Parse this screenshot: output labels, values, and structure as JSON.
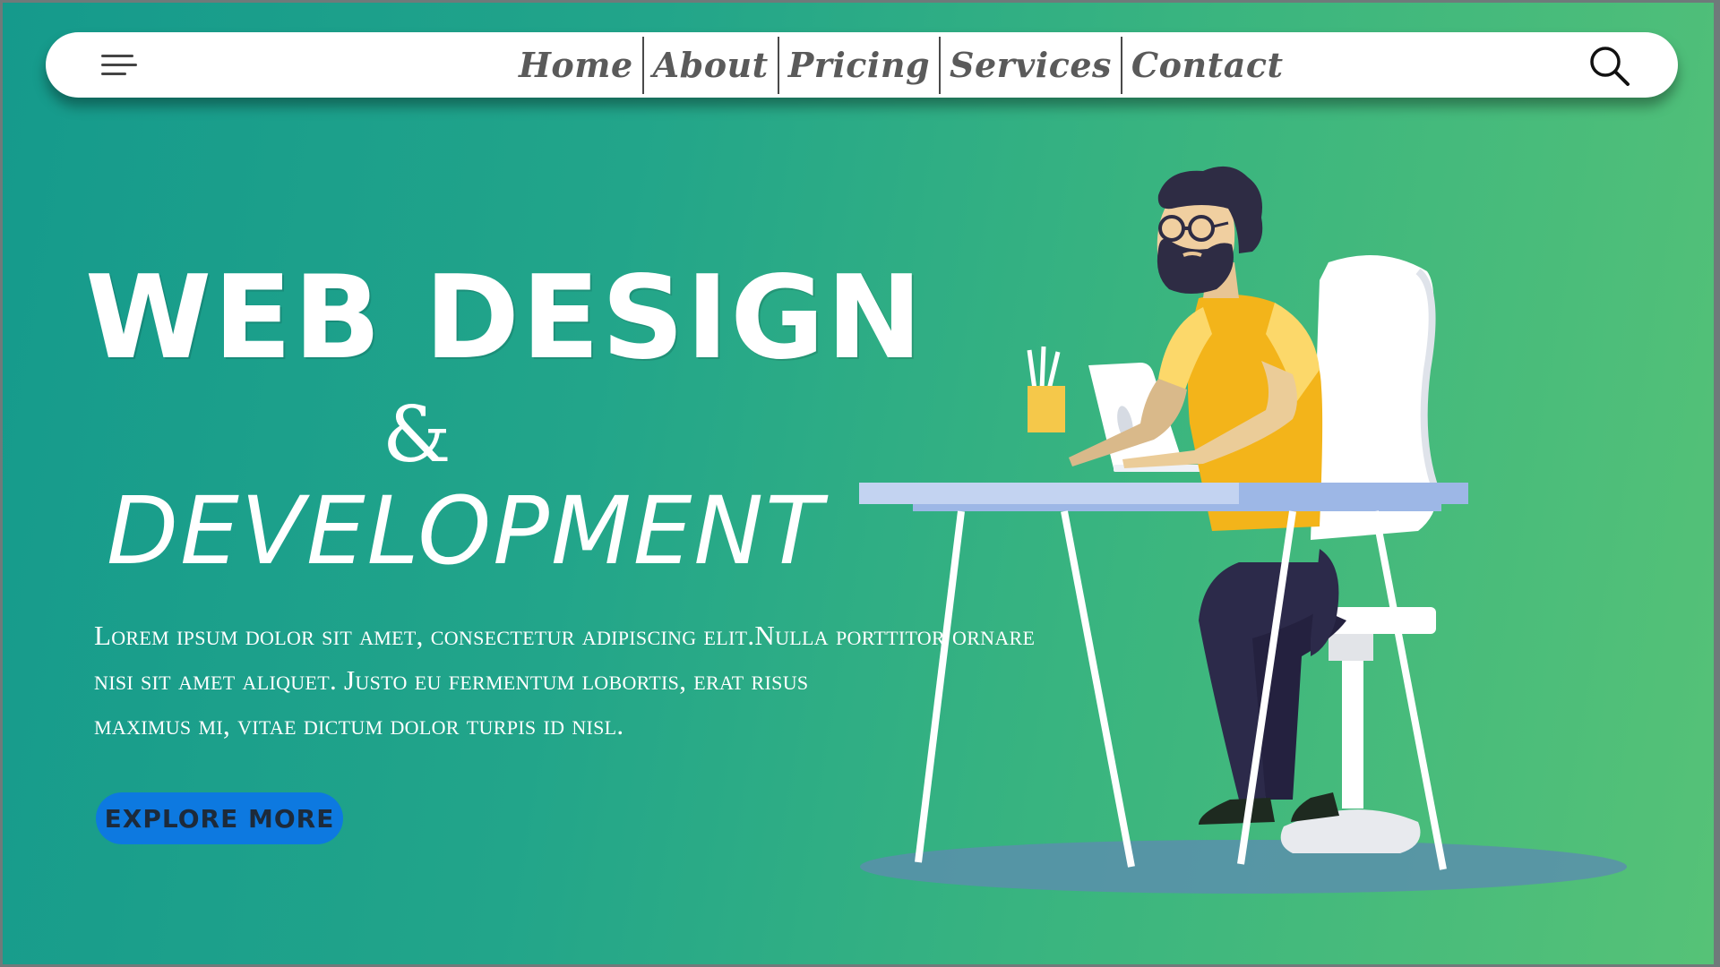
{
  "nav": {
    "menu_icon": "hamburger-menu-icon",
    "links": [
      "Home",
      "About",
      "Pricing",
      "Services",
      "Contact"
    ],
    "search_icon": "search-icon"
  },
  "hero": {
    "title_line1": "WEB DESIGN",
    "title_amp": "&",
    "title_line2": "DEVELOPMENT",
    "body_lines": [
      "Lorem ipsum dolor sit amet, consectetur adipiscing elit.Nulla porttitor ornare",
      " nisi sit amet aliquet. Justo eu fermentum lobortis, erat risus",
      "maximus mi, vitae dictum dolor turpis id nisl."
    ],
    "cta_label": "EXPLORE MORE"
  },
  "colors": {
    "gradient_start": "#159a8c",
    "gradient_end": "#56c277",
    "cta_background": "#0d79e0",
    "nav_background": "#ffffff",
    "shirt": "#f3b41a",
    "pants": "#2c2a4a"
  },
  "illustration": {
    "subject": "man-working-on-laptop-illustration"
  }
}
